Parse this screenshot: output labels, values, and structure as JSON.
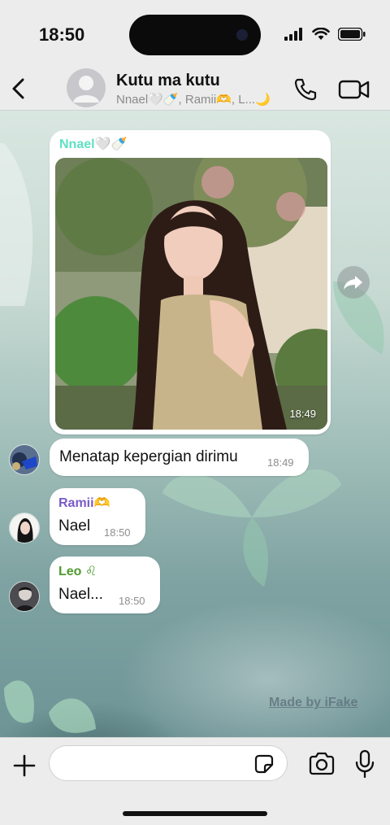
{
  "status_bar": {
    "time": "18:50"
  },
  "header": {
    "title": "Kutu ma kutu",
    "subtitle": "Nnael🤍🍼, Ramii🫶, L...🌙"
  },
  "messages": [
    {
      "type": "image",
      "sender": "Nnael🤍🍼",
      "sender_color": "#5fe0c3",
      "time": "18:49"
    },
    {
      "type": "text",
      "text": "Menatap kepergian dirimu",
      "time": "18:49"
    },
    {
      "type": "text",
      "sender": "Ramii🫶",
      "sender_color": "#7a5bc8",
      "text": "Nael",
      "time": "18:50"
    },
    {
      "type": "text",
      "sender": "Leo ♌",
      "sender_color": "#4f9a2e",
      "text": "Nael...",
      "time": "18:50"
    }
  ],
  "watermark": "Made by iFake",
  "input": {
    "placeholder": ""
  },
  "icons": [
    "back-icon",
    "group-avatar-icon",
    "phone-icon",
    "video-icon",
    "forward-icon",
    "plus-icon",
    "sticker-icon",
    "camera-icon",
    "mic-icon"
  ],
  "colors": {
    "bar_bg": "#ececec",
    "bubble_bg": "#ffffff",
    "time_text": "#8e8e8e"
  }
}
